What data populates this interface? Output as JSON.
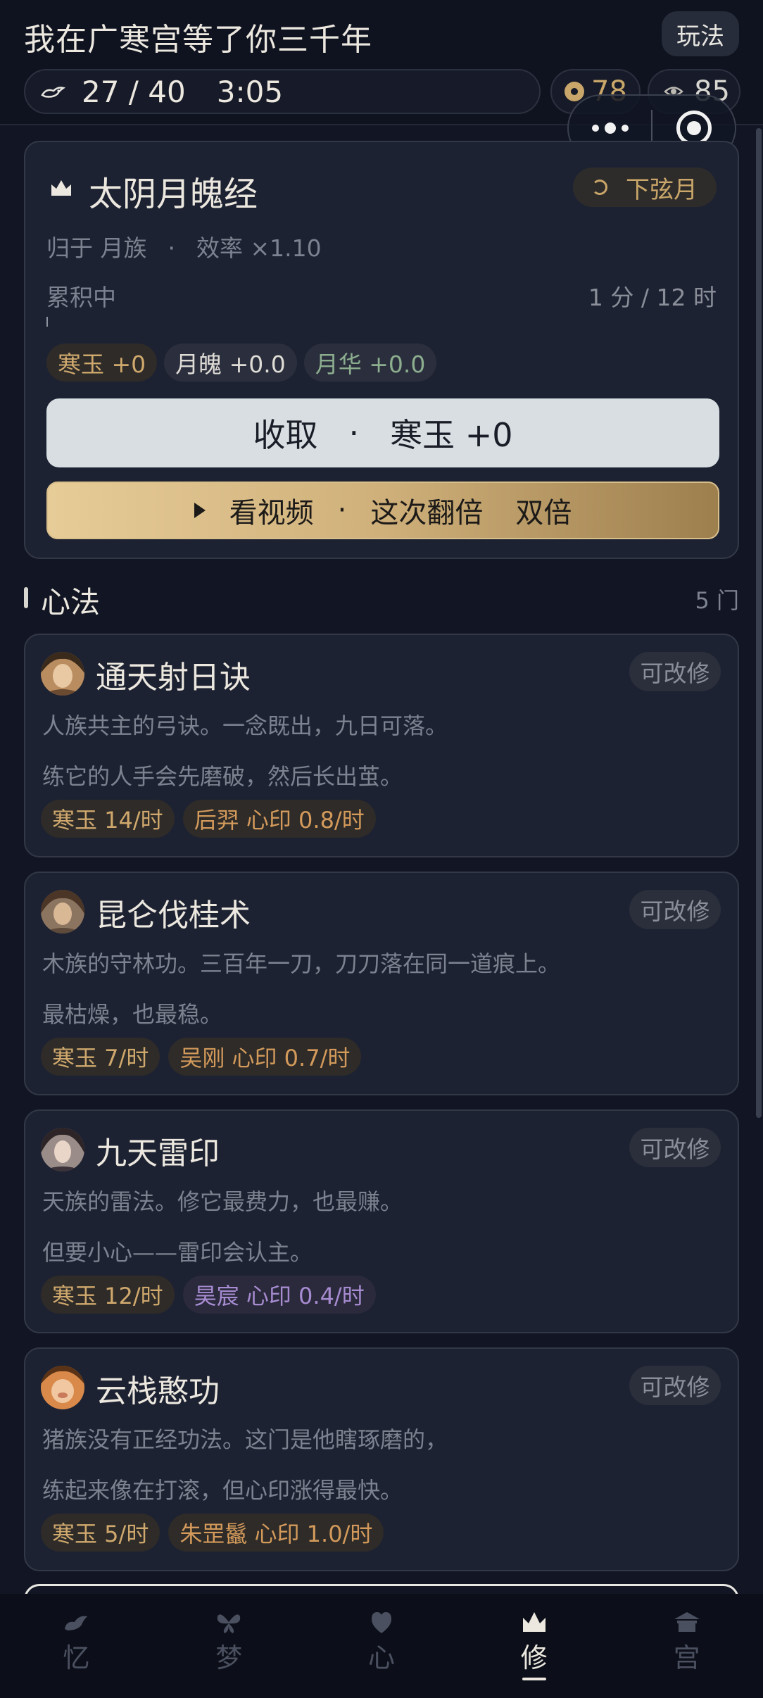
{
  "header": {
    "title": "我在广寒宫等了你三千年",
    "rules_label": "玩法",
    "progress": "27 / 40",
    "timer": "3:05",
    "coins": "78",
    "eyes": "85"
  },
  "main_card": {
    "title": "太阴月魄经",
    "moon_phase": "下弦月",
    "belongs": "归于 月族",
    "efficiency": "效率 ×1.10",
    "accumulating_label": "累积中",
    "accumulating_time": "1 分 / 12 时",
    "accumulation_progress": 0.002,
    "rewards": [
      {
        "label": "寒玉 +0",
        "color": "gold"
      },
      {
        "label": "月魄 +0.0",
        "color": "white"
      },
      {
        "label": "月华 +0.0",
        "color": "green"
      }
    ],
    "collect_label": "收取",
    "collect_value": "寒玉 +0",
    "video_label": "看视频",
    "video_mid": "这次翻倍",
    "video_end": "双倍"
  },
  "section": {
    "title": "心法",
    "count": "5 门"
  },
  "techniques": [
    {
      "name": "通天射日诀",
      "modify_label": "可改修",
      "desc1": "人族共主的弓诀。一念既出，九日可落。",
      "desc2": "练它的人手会先磨破，然后长出茧。",
      "tag1": "寒玉 14/时",
      "tag2": "后羿 心印 0.8/时",
      "tag2_color": "orange"
    },
    {
      "name": "昆仑伐桂术",
      "modify_label": "可改修",
      "desc1": "木族的守林功。三百年一刀，刀刀落在同一道痕上。",
      "desc2": "最枯燥，也最稳。",
      "tag1": "寒玉 7/时",
      "tag2": "吴刚 心印 0.7/时",
      "tag2_color": "orange"
    },
    {
      "name": "九天雷印",
      "modify_label": "可改修",
      "desc1": "天族的雷法。修它最费力，也最赚。",
      "desc2": "但要小心——雷印会认主。",
      "tag1": "寒玉 12/时",
      "tag2": "昊宸 心印 0.4/时",
      "tag2_color": "purple"
    },
    {
      "name": "云栈憨功",
      "modify_label": "可改修",
      "desc1": "猪族没有正经功法。这门是他瞎琢磨的，",
      "desc2": "练起来像在打滚，但心印涨得最快。",
      "tag1": "寒玉 5/时",
      "tag2": "朱罡鬣 心印 1.0/时",
      "tag2_color": "orange"
    }
  ],
  "nav": [
    {
      "label": "忆",
      "icon": "rabbit-icon"
    },
    {
      "label": "梦",
      "icon": "butterfly-icon"
    },
    {
      "label": "心",
      "icon": "heart-figure-icon"
    },
    {
      "label": "修",
      "icon": "crown-icon",
      "active": true
    },
    {
      "label": "宫",
      "icon": "palace-icon"
    }
  ],
  "colors": {
    "background": "#121624",
    "card": "#1d2232",
    "gold": "#cfa86d",
    "collect_button": "#d8dee2",
    "video_gradient_start": "#e7cc98",
    "video_gradient_end": "#9d7f4e"
  }
}
